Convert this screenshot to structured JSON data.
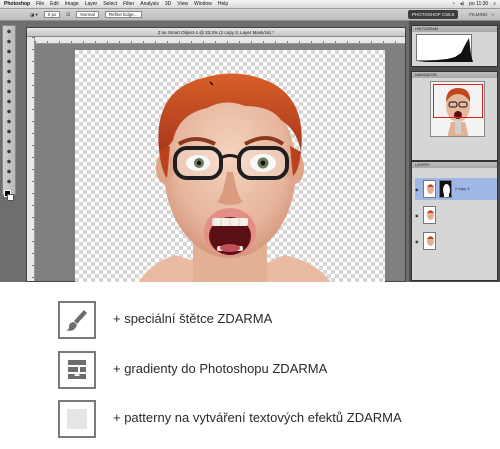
{
  "photoshop": {
    "app_name": "Photoshop",
    "menu": [
      "File",
      "Edit",
      "Image",
      "Layer",
      "Select",
      "Filter",
      "Analysis",
      "3D",
      "View",
      "Window",
      "Help"
    ],
    "clock": "po 11:30",
    "workspace_button": "PHOTOSHOP CS5.5",
    "workspace_extra": "FILMING",
    "document_title": "Z se Smart Object-1 @ 33.3% (2 copy 3, Layer Mask/16) *",
    "panels": {
      "histogram_tab": "HISTOGRAM",
      "navigator_tab": "NAVIGATOR",
      "layers_tab": "LAYERS",
      "selected_layer": "2 copy 3"
    }
  },
  "features": [
    {
      "icon": "brush-icon",
      "text": "+  speciální štětce ZDARMA"
    },
    {
      "icon": "gradient-panel-icon",
      "text": "+  gradienty do Photoshopu ZDARMA"
    },
    {
      "icon": "pattern-square-icon",
      "text": "+ patterny na vytváření textových efektů ZDARMA"
    }
  ],
  "colors": {
    "icon_border": "#7a7a7a",
    "text": "#2a2a2a",
    "selection_blue": "#9fb8e8",
    "hair": "#c2461c"
  }
}
